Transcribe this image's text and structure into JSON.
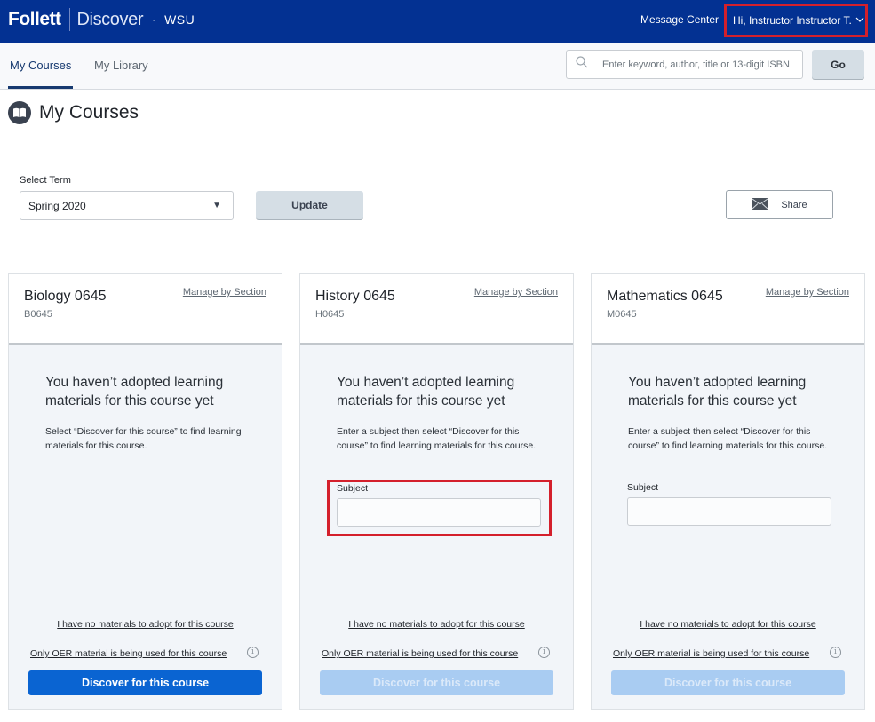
{
  "header": {
    "brand": "Follett",
    "product": "Discover",
    "separator_dot": "·",
    "school": "WSU",
    "message_center": "Message Center",
    "user_greeting": "Hi, Instructor Instructor T.",
    "user_menu_icon": "chevron-down-icon"
  },
  "nav": {
    "tabs": [
      {
        "label": "My Courses",
        "active": true
      },
      {
        "label": "My Library",
        "active": false
      }
    ],
    "search": {
      "placeholder": "Enter keyword, author, title or 13-digit ISBN",
      "value": "",
      "icon": "search-icon"
    },
    "go_label": "Go"
  },
  "page": {
    "title": "My Courses",
    "title_icon": "book-icon"
  },
  "term": {
    "label": "Select Term",
    "selected": "Spring 2020",
    "update_label": "Update",
    "share_label": "Share",
    "share_icon": "envelope-icon"
  },
  "colors": {
    "header_bg": "#033192",
    "highlight_red": "#d4202c",
    "primary_button": "#0a64d2",
    "disabled_button": "#a9ccf2",
    "tab_active": "#173a70"
  },
  "cards": [
    {
      "name": "Biology 0645",
      "code": "B0645",
      "manage_label": "Manage by Section",
      "empty_title": "You haven’t adopted learning materials for this course yet",
      "empty_desc": "Select “Discover for this course” to find learning materials for this course.",
      "has_subject": false,
      "no_materials_label": "I have no materials to adopt for this course",
      "oer_label": "Only OER material is being used for this course",
      "discover_label": "Discover for this course",
      "discover_enabled": true
    },
    {
      "name": "History 0645",
      "code": "H0645",
      "manage_label": "Manage by Section",
      "empty_title": "You haven’t adopted learning materials for this course yet",
      "empty_desc": "Enter a subject then select “Discover for this course” to find learning materials for this course.",
      "has_subject": true,
      "subject_label": "Subject",
      "subject_value": "",
      "subject_highlighted": true,
      "no_materials_label": "I have no materials to adopt for this course",
      "oer_label": "Only OER material is being used for this course",
      "discover_label": "Discover for this course",
      "discover_enabled": false
    },
    {
      "name": "Mathematics 0645",
      "code": "M0645",
      "manage_label": "Manage by Section",
      "empty_title": "You haven’t adopted learning materials for this course yet",
      "empty_desc": "Enter a subject then select “Discover for this course” to find learning materials for this course.",
      "has_subject": true,
      "subject_label": "Subject",
      "subject_value": "",
      "subject_highlighted": false,
      "no_materials_label": "I have no materials to adopt for this course",
      "oer_label": "Only OER material is being used for this course",
      "discover_label": "Discover for this course",
      "discover_enabled": false
    }
  ]
}
